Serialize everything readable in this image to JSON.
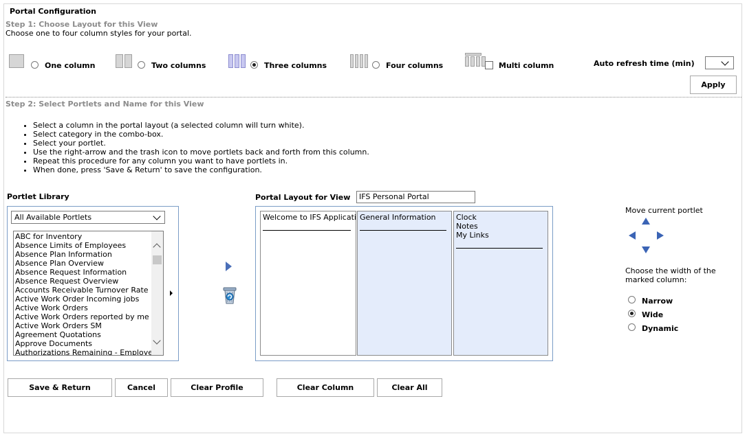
{
  "header": {
    "title": "Portal Configuration",
    "step1_title": "Step 1: Choose Layout for this View",
    "step1_desc": "Choose one to four column styles for your portal.",
    "step2_title": "Step 2: Select Portlets and Name for this View"
  },
  "layouts": [
    {
      "label": "One column",
      "selected": false
    },
    {
      "label": "Two columns",
      "selected": false
    },
    {
      "label": "Three columns",
      "selected": true
    },
    {
      "label": "Four columns",
      "selected": false
    },
    {
      "label": "Multi column",
      "checked": false
    }
  ],
  "refresh": {
    "label": "Auto refresh time (min)",
    "value": ""
  },
  "apply_label": "Apply",
  "instructions": [
    "Select a column in the portal layout (a selected column will turn white).",
    "Select category in the combo-box.",
    "Select your portlet.",
    "Use the right-arrow and the trash icon to move portlets back and forth from this column.",
    "Repeat this procedure for any column you want to have portlets in.",
    "When done, press 'Save & Return' to save the configuration."
  ],
  "library": {
    "label": "Portlet Library",
    "category": "All Available Portlets",
    "items": [
      "ABC for Inventory",
      "Absence Limits of Employees",
      "Absence Plan Information",
      "Absence Plan Overview",
      "Absence Request Information",
      "Absence Request Overview",
      "Accounts Receivable Turnover Rate",
      "Active Work Order Incoming jobs",
      "Active Work Orders",
      "Active Work Orders reported by me",
      "Active Work Orders SM",
      "Agreement Quotations",
      "Approve Documents",
      "Authorizations Remaining - Employee"
    ]
  },
  "layout_view": {
    "label": "Portal Layout for View",
    "name": "IFS Personal Portal",
    "columns": [
      {
        "items": [
          "Welcome to IFS Applications"
        ],
        "selected": true
      },
      {
        "items": [
          "General Information"
        ],
        "selected": false
      },
      {
        "items": [
          "Clock",
          "Notes",
          "My Links"
        ],
        "selected": false
      }
    ]
  },
  "move_panel": {
    "move_label": "Move current portlet",
    "width_label": "Choose the width of the marked column:",
    "width_options": [
      {
        "label": "Narrow",
        "selected": false
      },
      {
        "label": "Wide",
        "selected": true
      },
      {
        "label": "Dynamic",
        "selected": false
      }
    ]
  },
  "buttons": {
    "save_return": "Save & Return",
    "cancel": "Cancel",
    "clear_profile": "Clear Profile",
    "clear_column": "Clear Column",
    "clear_all": "Clear All"
  },
  "colors": {
    "step_gray": "#8c8c8c",
    "column_blue": "#e4ecfb",
    "panel_border": "#7a9cc6",
    "arrow_blue": "#3b64b5"
  }
}
